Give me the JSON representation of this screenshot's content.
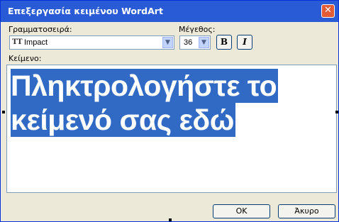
{
  "window": {
    "title": "Επεξεργασία κειμένου WordArt",
    "close_glyph": "✕"
  },
  "font": {
    "label": "Γραμματοσειρά:",
    "icon_text": "TT",
    "value": "Impact",
    "dropdown_glyph": "▼"
  },
  "size": {
    "label": "Μέγεθος:",
    "value": "36",
    "dropdown_glyph": "▼"
  },
  "style": {
    "bold": "B",
    "italic": "I"
  },
  "text": {
    "label": "Κείμενο:",
    "lines": [
      "Πληκτρολογήστε το",
      "κείμενό σας εδώ"
    ]
  },
  "buttons": {
    "ok": "OK",
    "cancel": "Άκυρο"
  },
  "colors": {
    "title_bar": "#2a5bd7",
    "selection": "#316ac5",
    "dialog_bg": "#ece9d8",
    "close_button": "#e35a36"
  }
}
